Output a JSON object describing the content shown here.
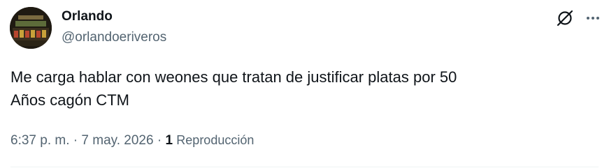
{
  "tweet": {
    "author": {
      "display_name": "Orlando",
      "handle": "@orlandoeriveros",
      "avatar_icon": "profile-photo"
    },
    "text_lines": [
      "Me carga hablar con weones que tratan de justificar platas por 50",
      "Años cagón CTM"
    ],
    "time": "6:37 p. m.",
    "separator": "·",
    "date": "7 may. 2026",
    "views_count": "1",
    "views_label": "Reproducción"
  },
  "icons": {
    "grok": "grok-icon",
    "more": "more-options-icon"
  },
  "colors": {
    "primary_text": "#0f1419",
    "secondary_text": "#536471",
    "divider": "#eff3f4"
  }
}
